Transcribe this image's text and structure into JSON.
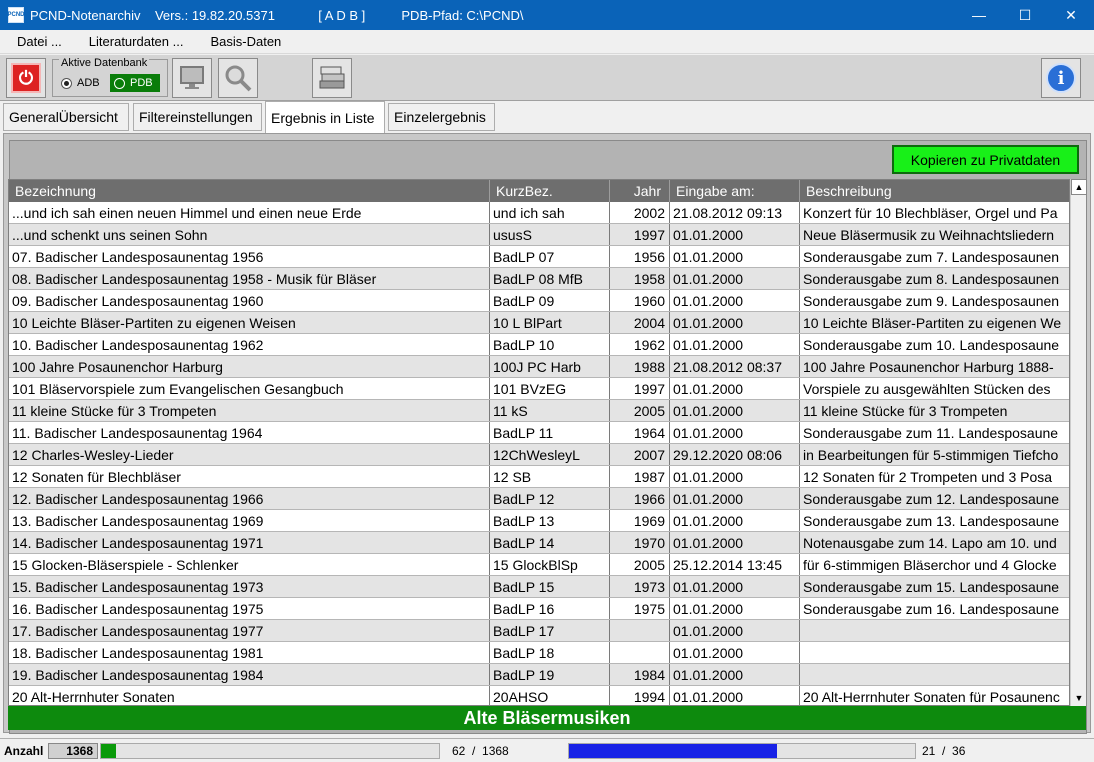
{
  "window": {
    "title": "PCND-Notenarchiv    Vers.: 19.82.20.5371            [ A D B ]          PDB-Pfad: C:\\PCND\\",
    "app_icon_text": "PCND",
    "minimize": "—",
    "maximize": "☐",
    "close": "✕"
  },
  "menu": [
    {
      "label": "Datei ..."
    },
    {
      "label": "Literaturdaten ..."
    },
    {
      "label": "Basis-Daten"
    }
  ],
  "toolbar": {
    "power_icon": "⏻",
    "db_group_label": "Aktive Datenbank",
    "adb_label": "ADB",
    "pdb_label": "PDB",
    "info_icon": "i"
  },
  "tabs": [
    {
      "label": "GeneralÜbersicht"
    },
    {
      "label": "Filtereinstellungen"
    },
    {
      "label": "Ergebnis in Liste"
    },
    {
      "label": "Einzelergebnis"
    }
  ],
  "copy_button": "Kopieren zu Privatdaten",
  "table": {
    "columns": [
      "Bezeichnung",
      "KurzBez.",
      "Jahr",
      "Eingabe am:",
      "Beschreibung"
    ],
    "rows": [
      [
        "...und ich sah einen neuen Himmel und einen neue Erde",
        "und ich sah",
        "2002",
        "21.08.2012 09:13",
        "Konzert für 10 Blechbläser, Orgel und Pa"
      ],
      [
        "...und schenkt uns seinen Sohn",
        "ususS",
        "1997",
        "01.01.2000",
        "Neue Bläsermusik zu Weihnachtsliedern"
      ],
      [
        "07. Badischer Landesposaunentag 1956",
        "BadLP 07",
        "1956",
        "01.01.2000",
        "Sonderausgabe zum 7. Landesposaunen"
      ],
      [
        "08. Badischer Landesposaunentag 1958 - Musik für Bläser",
        "BadLP 08 MfB",
        "1958",
        "01.01.2000",
        "Sonderausgabe zum 8. Landesposaunen"
      ],
      [
        "09. Badischer Landesposaunentag 1960",
        "BadLP 09",
        "1960",
        "01.01.2000",
        "Sonderausgabe zum 9. Landesposaunen"
      ],
      [
        "10 Leichte Bläser-Partiten zu eigenen Weisen",
        "10 L BlPart",
        "2004",
        "01.01.2000",
        "10 Leichte Bläser-Partiten zu eigenen We"
      ],
      [
        "10. Badischer Landesposaunentag 1962",
        "BadLP 10",
        "1962",
        "01.01.2000",
        "Sonderausgabe zum 10. Landesposaune"
      ],
      [
        "100 Jahre Posaunenchor Harburg",
        "100J PC Harb",
        "1988",
        "21.08.2012 08:37",
        "100 Jahre Posaunenchor Harburg 1888-"
      ],
      [
        "101 Bläservorspiele zum Evangelischen Gesangbuch",
        "101 BVzEG",
        "1997",
        "01.01.2000",
        "Vorspiele zu ausgewählten Stücken des"
      ],
      [
        "11 kleine Stücke für 3 Trompeten",
        "11 kS",
        "2005",
        "01.01.2000",
        "11 kleine Stücke für 3 Trompeten"
      ],
      [
        "11. Badischer Landesposaunentag 1964",
        "BadLP 11",
        "1964",
        "01.01.2000",
        "Sonderausgabe zum 11. Landesposaune"
      ],
      [
        "12 Charles-Wesley-Lieder",
        "12ChWesleyL",
        "2007",
        "29.12.2020 08:06",
        "in Bearbeitungen für 5-stimmigen Tiefcho"
      ],
      [
        "12 Sonaten für Blechbläser",
        "12 SB",
        "1987",
        "01.01.2000",
        "12 Sonaten für 2 Trompeten und 3 Posa"
      ],
      [
        "12. Badischer Landesposaunentag 1966",
        "BadLP 12",
        "1966",
        "01.01.2000",
        "Sonderausgabe zum 12. Landesposaune"
      ],
      [
        "13. Badischer Landesposaunentag 1969",
        "BadLP 13",
        "1969",
        "01.01.2000",
        "Sonderausgabe zum 13. Landesposaune"
      ],
      [
        "14. Badischer Landesposaunentag 1971",
        "BadLP 14",
        "1970",
        "01.01.2000",
        "Notenausgabe zum 14. Lapo am 10. und"
      ],
      [
        "15 Glocken-Bläserspiele - Schlenker",
        "15 GlockBlSp",
        "2005",
        "25.12.2014 13:45",
        "für 6-stimmigen Bläserchor und 4 Glocke"
      ],
      [
        "15. Badischer Landesposaunentag 1973",
        "BadLP 15",
        "1973",
        "01.01.2000",
        "Sonderausgabe zum 15. Landesposaune"
      ],
      [
        "16. Badischer Landesposaunentag 1975",
        "BadLP 16",
        "1975",
        "01.01.2000",
        "Sonderausgabe zum 16. Landesposaune"
      ],
      [
        "17. Badischer Landesposaunentag 1977",
        "BadLP 17",
        "",
        "01.01.2000",
        ""
      ],
      [
        "18. Badischer Landesposaunentag 1981",
        "BadLP 18",
        "",
        "01.01.2000",
        ""
      ],
      [
        "19. Badischer Landesposaunentag 1984",
        "BadLP 19",
        "1984",
        "01.01.2000",
        ""
      ],
      [
        "20 Alt-Herrnhuter Sonaten",
        "20AHSO",
        "1994",
        "01.01.2000",
        "20 Alt-Herrnhuter Sonaten für Posaunenc"
      ]
    ]
  },
  "footer_band": "Alte Bläsermusiken",
  "statusbar": {
    "label": "Anzahl",
    "count": "1368",
    "position": "62  /  1368",
    "position_fraction": 0.045,
    "page": "21  /  36",
    "page_fraction": 0.6
  }
}
